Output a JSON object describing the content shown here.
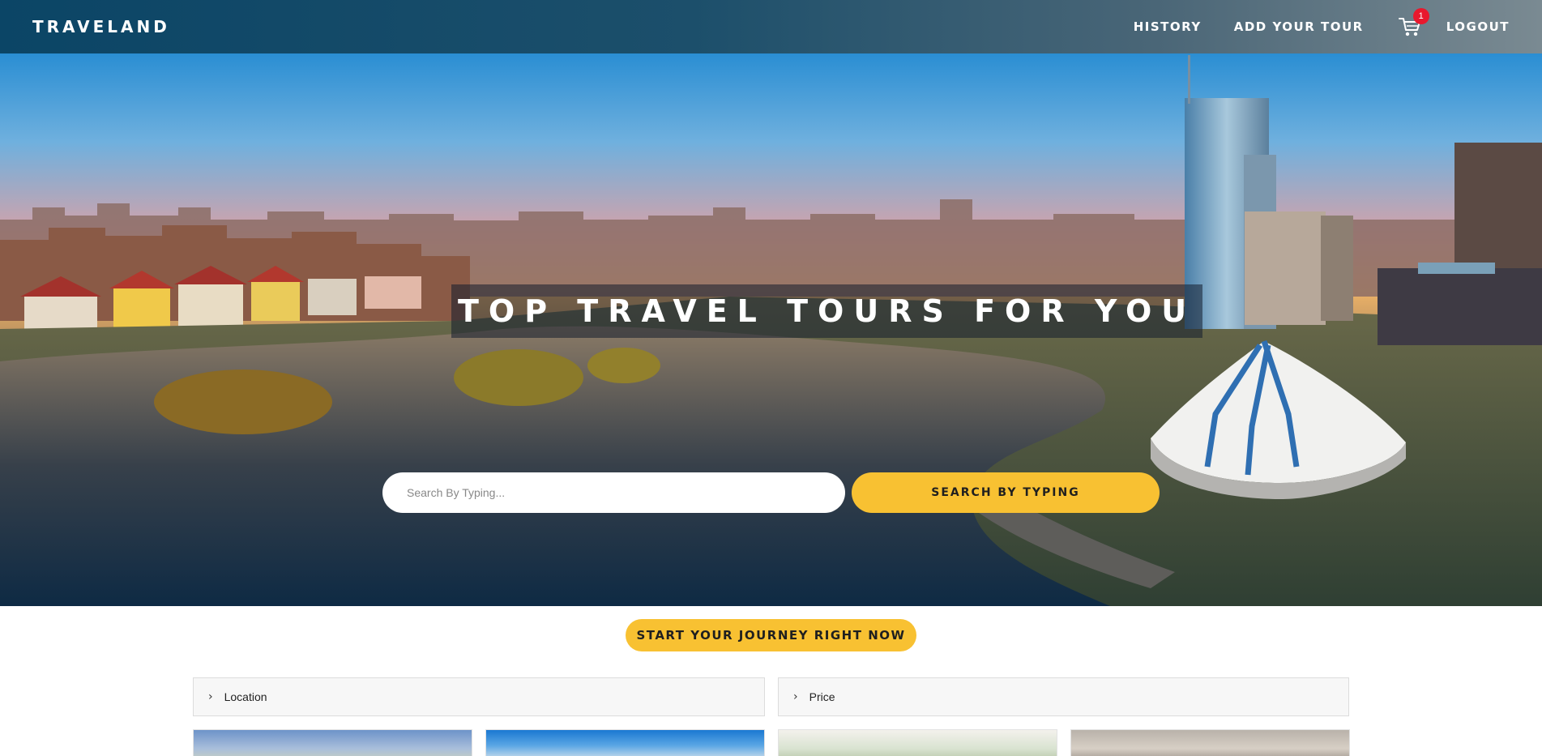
{
  "navbar": {
    "brand": "TRAVELAND",
    "links": {
      "history": "HISTORY",
      "add_tour": "ADD YOUR TOUR",
      "logout": "LOGOUT"
    },
    "cart": {
      "icon": "cart-icon",
      "badge_count": "1"
    }
  },
  "hero": {
    "title": "TOP TRAVEL TOURS FOR YOU",
    "search": {
      "placeholder": "Search By Typing...",
      "value": "",
      "button_label": "SEARCH BY TYPING"
    }
  },
  "start_button_label": "START YOUR JOURNEY RIGHT NOW",
  "filters": {
    "location": {
      "label": "Location",
      "icon": "chevron-right-icon"
    },
    "price": {
      "label": "Price",
      "icon": "chevron-right-icon"
    }
  },
  "cards_count": 4,
  "colors": {
    "accent_yellow": "#f8c132",
    "badge_red": "#e8182d",
    "nav_gradient_start": "#0b4566",
    "nav_gradient_end": "#7a8a92"
  }
}
